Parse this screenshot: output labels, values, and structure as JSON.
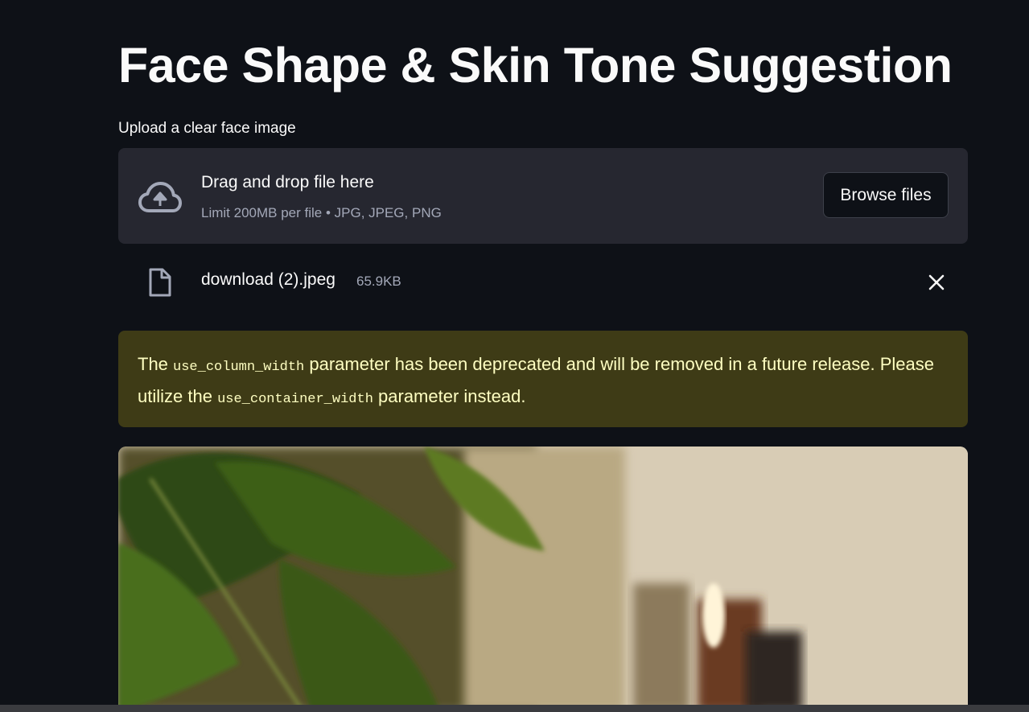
{
  "page": {
    "title": "Face Shape & Skin Tone Suggestion"
  },
  "uploader": {
    "label": "Upload a clear face image",
    "drop_title": "Drag and drop file here",
    "limit_text": "Limit 200MB per file • JPG, JPEG, PNG",
    "browse_label": "Browse files",
    "icon": "cloud-upload-icon"
  },
  "uploaded_file": {
    "name": "download (2).jpeg",
    "size": "65.9KB",
    "icon": "file-icon",
    "remove_icon": "close-icon"
  },
  "warning": {
    "text_1": "The ",
    "code_1": "use_column_width",
    "text_2": " parameter has been deprecated and will be removed in a future release. Please utilize the ",
    "code_2": "use_container_width",
    "text_3": " parameter instead."
  },
  "colors": {
    "background": "#0e1117",
    "dropzone": "#262730",
    "warning_bg": "#3e3b16",
    "warning_text": "#ffffc2",
    "muted_text": "#a3a8b8"
  }
}
